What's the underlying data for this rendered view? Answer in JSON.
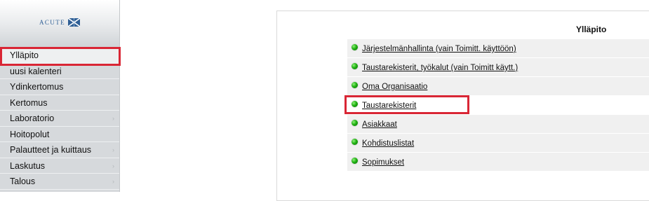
{
  "logo": {
    "text": "ACUTE"
  },
  "sidebar": {
    "items": [
      {
        "label": "Ylläpito",
        "has_submenu": false,
        "highlighted": true
      },
      {
        "label": "uusi kalenteri",
        "has_submenu": false
      },
      {
        "label": "Ydinkertomus",
        "has_submenu": false
      },
      {
        "label": "Kertomus",
        "has_submenu": false
      },
      {
        "label": "Laboratorio",
        "has_submenu": true
      },
      {
        "label": "Hoitopolut",
        "has_submenu": false
      },
      {
        "label": "Palautteet ja kuittaus",
        "has_submenu": true
      },
      {
        "label": "Laskutus",
        "has_submenu": true
      },
      {
        "label": "Talous",
        "has_submenu": true
      }
    ],
    "arrow_glyph": "›"
  },
  "main": {
    "title": "Ylläpito",
    "links": [
      {
        "label": "Järjestelmänhallinta (vain Toimitt. käyttöön)"
      },
      {
        "label": "Taustarekisterit, työkalut (vain Toimitt käytt.)"
      },
      {
        "label": "Oma Organisaatio"
      },
      {
        "label": "Taustarekisterit",
        "highlighted": true
      },
      {
        "label": "Asiakkaat"
      },
      {
        "label": "Kohdistuslistat"
      },
      {
        "label": "Sopimukset"
      }
    ]
  },
  "colors": {
    "highlight": "#d92635",
    "bullet": "#20b212",
    "logo": "#2f5f95",
    "sidebar_bg": "#d6d9dc"
  }
}
